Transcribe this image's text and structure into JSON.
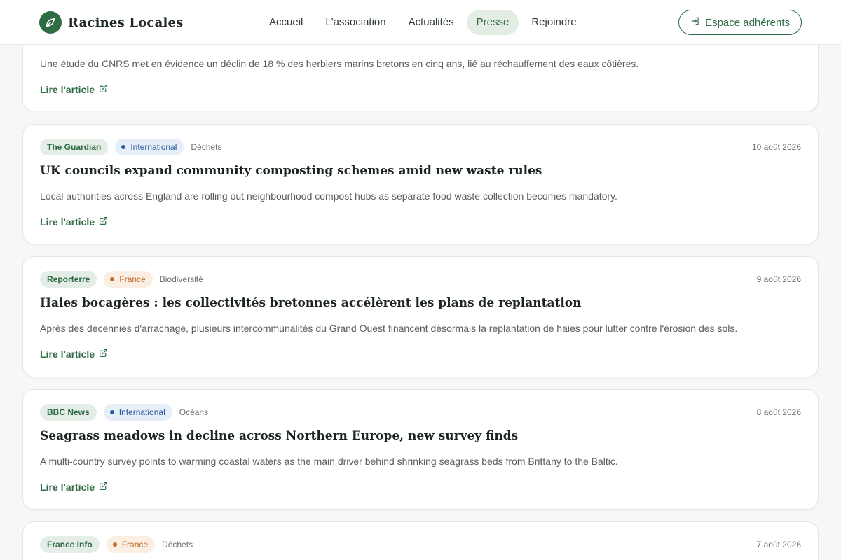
{
  "header": {
    "brand": "Racines Locales",
    "nav": [
      "Accueil",
      "L'association",
      "Actualités",
      "Presse",
      "Rejoindre"
    ],
    "active_nav": "Presse",
    "member_button": "Espace adhérents"
  },
  "colors": {
    "brand_green": "#2f6b45",
    "international": "#2a5a9c",
    "france": "#c26a2a"
  },
  "feed": {
    "read_label": "Lire l'article",
    "partial_top_summary": "Une étude du CNRS met en évidence un déclin de 18 % des herbiers marins bretons en cinq ans, lié au réchauffement des eaux côtières.",
    "articles": [
      {
        "source": "The Guardian",
        "region": "International",
        "category": "Déchets",
        "date": "10 août 2026",
        "title": "UK councils expand community composting schemes amid new waste rules",
        "summary": "Local authorities across England are rolling out neighbourhood compost hubs as separate food waste collection becomes mandatory."
      },
      {
        "source": "Reporterre",
        "region": "France",
        "category": "Biodiversité",
        "date": "9 août 2026",
        "title": "Haies bocagères : les collectivités bretonnes accélèrent les plans de replantation",
        "summary": "Après des décennies d'arrachage, plusieurs intercommunalités du Grand Ouest financent désormais la replantation de haies pour lutter contre l'érosion des sols."
      },
      {
        "source": "BBC News",
        "region": "International",
        "category": "Océans",
        "date": "8 août 2026",
        "title": "Seagrass meadows in decline across Northern Europe, new survey finds",
        "summary": "A multi-country survey points to warming coastal waters as the main driver behind shrinking seagrass beds from Brittany to the Baltic."
      },
      {
        "source": "France Info",
        "region": "France",
        "category": "Déchets",
        "date": "7 août 2026"
      }
    ]
  }
}
